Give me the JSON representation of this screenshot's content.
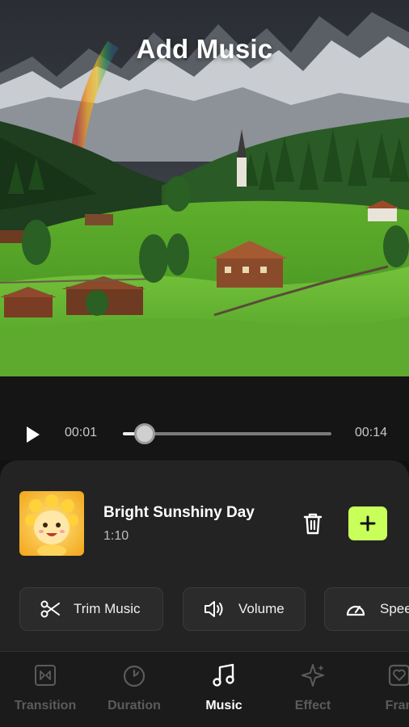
{
  "header": {
    "title": "Add Music"
  },
  "player": {
    "current_time": "00:01",
    "total_time": "00:14",
    "progress": 0.07
  },
  "song": {
    "title": "Bright Sunshiny Day",
    "duration": "1:10"
  },
  "actions": [
    {
      "label": "Trim Music",
      "icon": "scissors-icon"
    },
    {
      "label": "Volume",
      "icon": "volume-icon"
    },
    {
      "label": "Spee",
      "icon": "speedometer-icon"
    }
  ],
  "tabs": [
    {
      "label": "Transition",
      "icon": "transition-icon",
      "active": false
    },
    {
      "label": "Duration",
      "icon": "timer-icon",
      "active": false
    },
    {
      "label": "Music",
      "icon": "music-note-icon",
      "active": true
    },
    {
      "label": "Effect",
      "icon": "sparkle-icon",
      "active": false
    },
    {
      "label": "Fran",
      "icon": "frame-icon",
      "active": false
    }
  ],
  "colors": {
    "accent": "#c8ff5a",
    "panel": "#232323",
    "nav": "#1b1b1b"
  }
}
